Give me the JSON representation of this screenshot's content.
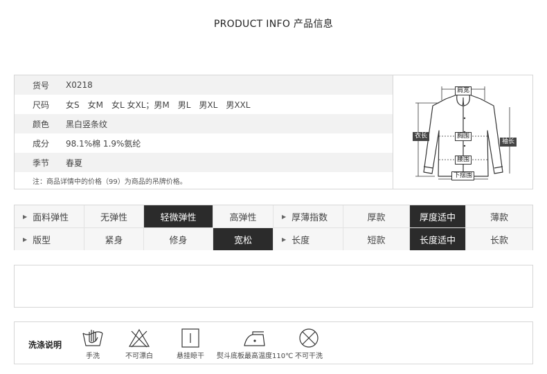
{
  "title": "PRODUCT INFO  产品信息",
  "info": {
    "rows": [
      {
        "key": "货号",
        "value": "X0218"
      },
      {
        "key": "尺码",
        "value": "女S　女M　女L 女XL；男M　男L　男XL　男XXL"
      },
      {
        "key": "颜色",
        "value": "黑白竖条纹"
      },
      {
        "key": "成分",
        "value": "98.1%棉 1.9%氨纶"
      },
      {
        "key": "季节",
        "value": "春夏"
      }
    ],
    "note": "注：商品详情中的价格（99）为商品的吊牌价格。"
  },
  "diagram": {
    "shoulder": "肩宽",
    "length": "衣长",
    "chest": "胸围",
    "sleeve": "袖长",
    "waist": "腰围",
    "hem": "下摆围"
  },
  "attributes": {
    "row1": {
      "elasticity_label": "面料弹性",
      "elasticity_options": [
        "无弹性",
        "轻微弹性",
        "高弹性"
      ],
      "elasticity_selected": 1,
      "thickness_label": "厚薄指数",
      "thickness_options": [
        "厚款",
        "厚度适中",
        "薄款"
      ],
      "thickness_selected": 1
    },
    "row2": {
      "fit_label": "版型",
      "fit_options": [
        "紧身",
        "修身",
        "宽松"
      ],
      "fit_selected": 2,
      "length_label": "长度",
      "length_options": [
        "短款",
        "长度适中",
        "长款"
      ],
      "length_selected": 1
    }
  },
  "care": {
    "title": "洗涤说明",
    "items": [
      {
        "icon": "hand-wash-icon",
        "label": "手洗"
      },
      {
        "icon": "no-bleach-icon",
        "label": "不可漂白"
      },
      {
        "icon": "hang-dry-icon",
        "label": "悬挂晾干"
      },
      {
        "icon": "iron-icon",
        "label": "熨斗底板最高温度110℃"
      },
      {
        "icon": "no-dry-clean-icon",
        "label": "不可干洗"
      }
    ]
  }
}
